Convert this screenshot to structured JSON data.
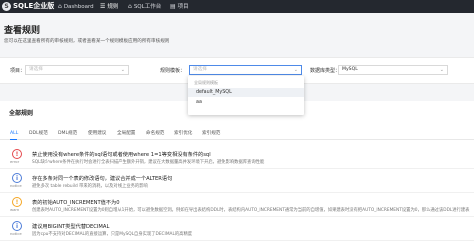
{
  "nav": {
    "logo": "SQLE企业版",
    "items": [
      {
        "icon": "⌂",
        "label": "Dashboard"
      },
      {
        "icon": "☰",
        "label": "规则"
      },
      {
        "icon": "⌂",
        "label": "SQL工作台"
      },
      {
        "icon": "▤",
        "label": "项目"
      }
    ]
  },
  "page": {
    "title": "查看规则",
    "description": "您可以在这里查看所有的审核规则，或者查看某一个规则模板应用的所有审核规则"
  },
  "filters": {
    "project_label": "项目：",
    "project_placeholder": "请选择",
    "template_label": "规则模板：",
    "template_placeholder": "请选择",
    "dbtype_label": "数据库类型：",
    "dbtype_value": "MySQL"
  },
  "dropdown": {
    "group_label": "全局规则模板",
    "options": [
      "default_MySQL",
      "aa"
    ]
  },
  "rules_section": {
    "title": "全部规则",
    "tabs": [
      "ALL",
      "DDL规范",
      "DML规范",
      "使用建议",
      "全局配置",
      "命名规范",
      "索引优化",
      "索引规范"
    ],
    "rules": [
      {
        "level": "error",
        "icon": "!",
        "color": "#e5484d",
        "title": "禁止使用没有where条件的sql语句或者使用where 1=1等变相没有条件的sql",
        "desc": "SQL缺少where条件在执行时会进行全表扫描产生额外开销，建议在大数据量高并发环境下开启，避免影响数据库查询性能"
      },
      {
        "level": "notice",
        "icon": "i",
        "color": "#4e7dd8",
        "title": "存在多条对同一个表的修改语句，建议合并成一个ALTER语句",
        "desc": "避免多次 table rebuild 带来的消耗，以及对线上业务的影响"
      },
      {
        "level": "warn",
        "icon": "!",
        "color": "#f5a623",
        "title": "表的初始AUTO_INCREMENT值不为0",
        "desc": "创建表时AUTO_INCREMENT设置为0则自增从1开始，可以避免数据空洞。例如在导出表结构DDL时，表结构内AUTO_INCREMENT通常为当前的自增值，如果建表时没有把AUTO_INCREMENT设置为0，那么通过该DDL进行建表"
      },
      {
        "level": "notice",
        "icon": "i",
        "color": "#4e7dd8",
        "title": "建议用BIGINT类型代替DECIMAL",
        "desc": "因为cpu不支持对DECIMAL的直接运算，只是MySQL自身实现了DECIMAL的高精度"
      }
    ]
  }
}
